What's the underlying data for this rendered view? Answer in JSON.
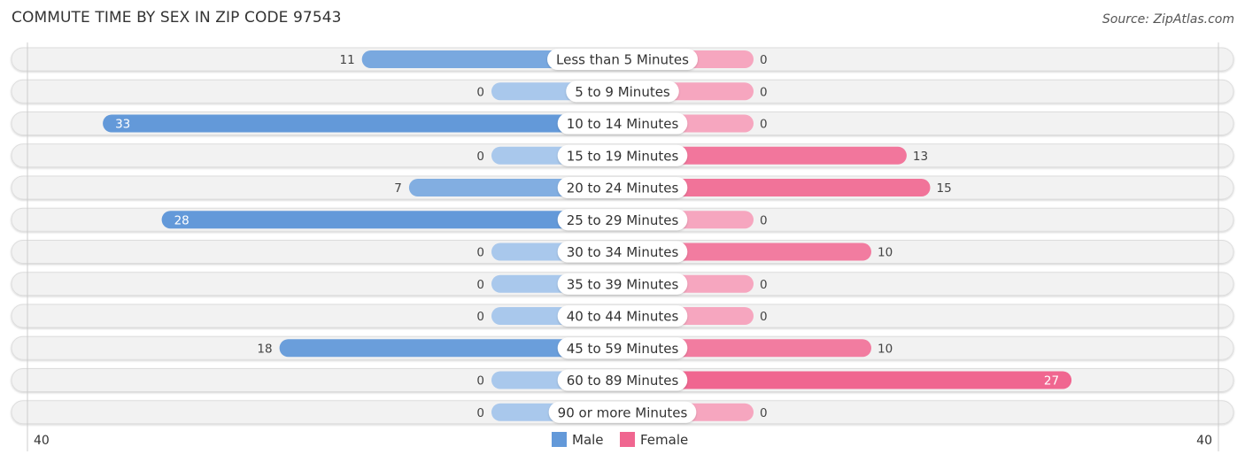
{
  "header": {
    "title": "COMMUTE TIME BY SEX IN ZIP CODE 97543",
    "source": "Source: ZipAtlas.com"
  },
  "colors": {
    "male_strong": "#6399d9",
    "male_light": "#a9c8ec",
    "female_strong": "#f06690",
    "female_light": "#f6a6bf",
    "track": "#f2f2f2"
  },
  "chart_data": {
    "type": "bar",
    "orientation": "horizontal-diverging",
    "title": "COMMUTE TIME BY SEX IN ZIP CODE 97543",
    "categories": [
      "Less than 5 Minutes",
      "5 to 9 Minutes",
      "10 to 14 Minutes",
      "15 to 19 Minutes",
      "20 to 24 Minutes",
      "25 to 29 Minutes",
      "30 to 34 Minutes",
      "35 to 39 Minutes",
      "40 to 44 Minutes",
      "45 to 59 Minutes",
      "60 to 89 Minutes",
      "90 or more Minutes"
    ],
    "series": [
      {
        "name": "Male",
        "side": "left",
        "values": [
          11,
          0,
          33,
          0,
          7,
          28,
          0,
          0,
          0,
          18,
          0,
          0
        ]
      },
      {
        "name": "Female",
        "side": "right",
        "values": [
          0,
          0,
          0,
          13,
          15,
          0,
          10,
          0,
          0,
          10,
          27,
          0
        ]
      }
    ],
    "axis": {
      "left_max_label": "40",
      "right_max_label": "40",
      "range": [
        0,
        40
      ]
    },
    "legend": {
      "position": "bottom-center",
      "items": [
        "Male",
        "Female"
      ]
    },
    "grid": false
  }
}
